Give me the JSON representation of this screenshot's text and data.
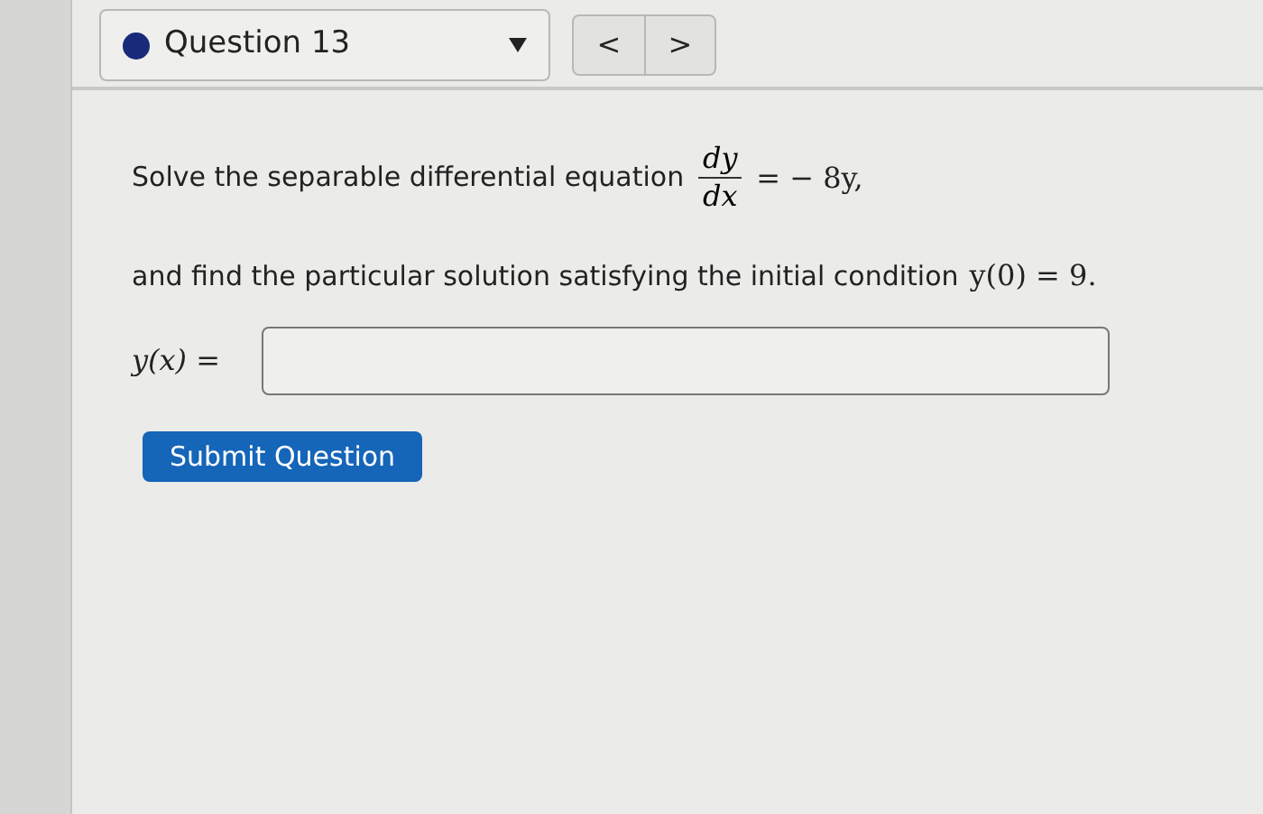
{
  "question_selector": {
    "label": "Question 13"
  },
  "nav_buttons": [
    "<",
    ">"
  ],
  "prompt": {
    "text": "Solve the separable differential equation",
    "numerator": "dy",
    "denominator": "dx",
    "rhs": "= − 8y,"
  },
  "condition": {
    "text": "and find the particular solution satisfying the initial condition",
    "math": "y(0) = 9."
  },
  "answer": {
    "label": "y(x) ="
  },
  "submit_button": "Submit Question"
}
